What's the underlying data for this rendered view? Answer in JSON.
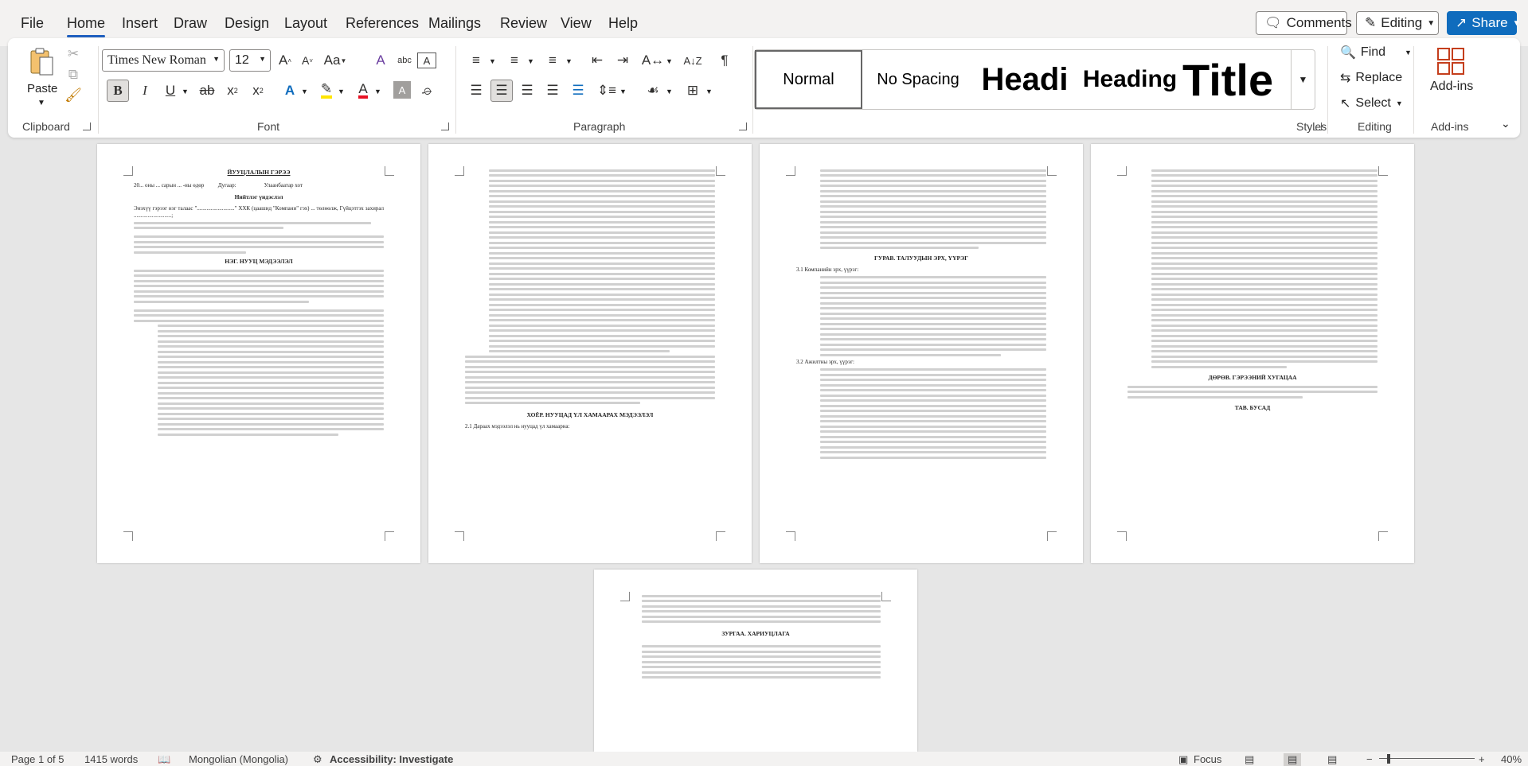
{
  "menu": {
    "file": "File",
    "home": "Home",
    "insert": "Insert",
    "draw": "Draw",
    "design": "Design",
    "layout": "Layout",
    "references": "References",
    "mailings": "Mailings",
    "review": "Review",
    "view": "View",
    "help": "Help"
  },
  "top_buttons": {
    "comments": "Comments",
    "editing": "Editing",
    "share": "Share"
  },
  "ribbon": {
    "clipboard": {
      "paste": "Paste",
      "label": "Clipboard"
    },
    "font": {
      "name": "Times New Roman",
      "size": "12",
      "label": "Font"
    },
    "paragraph": {
      "label": "Paragraph"
    },
    "styles": {
      "label": "Styles",
      "items": [
        "Normal",
        "No Spacing",
        "Headi",
        "Heading",
        "Title"
      ]
    },
    "editing": {
      "find": "Find",
      "replace": "Replace",
      "select": "Select",
      "label": "Editing"
    },
    "addins": {
      "button": "Add-ins",
      "label": "Add-ins"
    }
  },
  "pages": {
    "p1": {
      "title": "ЙУУЦЛАЛЫН ГЭРЭЭ",
      "date_line": "20... оны ... сарын ... -ны өдөр          Дугаар:                    Улаанбаатар хот",
      "preamble_head": "Нийтлэг үндэслэл",
      "intro": "Энэхүү гэрээг нэг талаас \"...........................\" ХХК (цаашид \"Компани\" гэх) ... төлөөлж, Гүйцэтгэх захирал ...........................;",
      "section1": "НЭГ. НУУЦ МЭДЭЭЛЭЛ"
    },
    "p2": {
      "section": "ХОЁР. НУУЦАД ҮЛ ХАМААРАХ МЭДЭЭЛЭЛ",
      "last": "2.1  Дараах мэдээлэл нь нууцад үл хамаарна:"
    },
    "p3": {
      "section": "ГУРАВ. ТАЛУУДЫН ЭРХ, ҮҮРЭГ",
      "sub1": "3.1  Компанийн эрх, үүрэг:",
      "sub2": "3.2  Ажилтны эрх, үүрэг:"
    },
    "p4": {
      "section4": "ДӨРӨВ. ГЭРЭЭНИЙ ХУГАЦАА",
      "section5": "ТАВ. БУСАД"
    },
    "p5": {
      "section": "ЗУРГАА. ХАРИУЦЛАГА"
    }
  },
  "status": {
    "page": "Page 1 of 5",
    "words": "1415 words",
    "language": "Mongolian (Mongolia)",
    "accessibility": "Accessibility: Investigate",
    "focus": "Focus",
    "zoom": "40%"
  }
}
